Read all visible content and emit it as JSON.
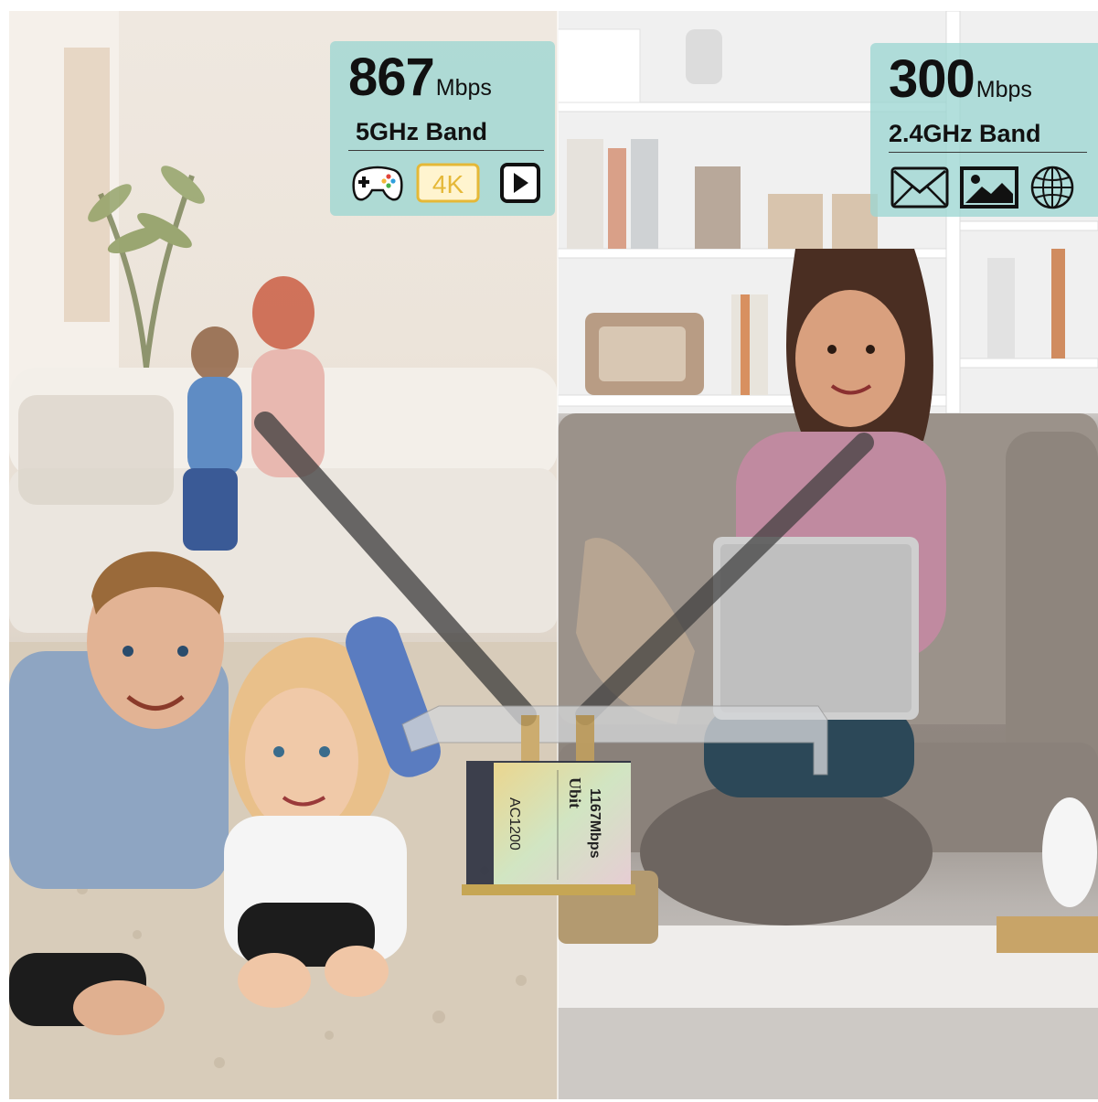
{
  "left_badge": {
    "speed_value": "867",
    "speed_unit": "Mbps",
    "band": "5GHz Band",
    "icons": [
      "gamepad-icon",
      "4k-icon",
      "play-icon"
    ],
    "label_4k": "4K"
  },
  "right_badge": {
    "speed_value": "300",
    "speed_unit": "Mbps",
    "band": "2.4GHz Band",
    "icons": [
      "mail-icon",
      "image-icon",
      "globe-icon"
    ]
  },
  "card": {
    "model": "AC1200",
    "brand": "Ubit",
    "speed_label": "1167Mbps"
  },
  "colors": {
    "badge_bg": "#9cd6d2",
    "badge_4k": "#e5b837"
  }
}
